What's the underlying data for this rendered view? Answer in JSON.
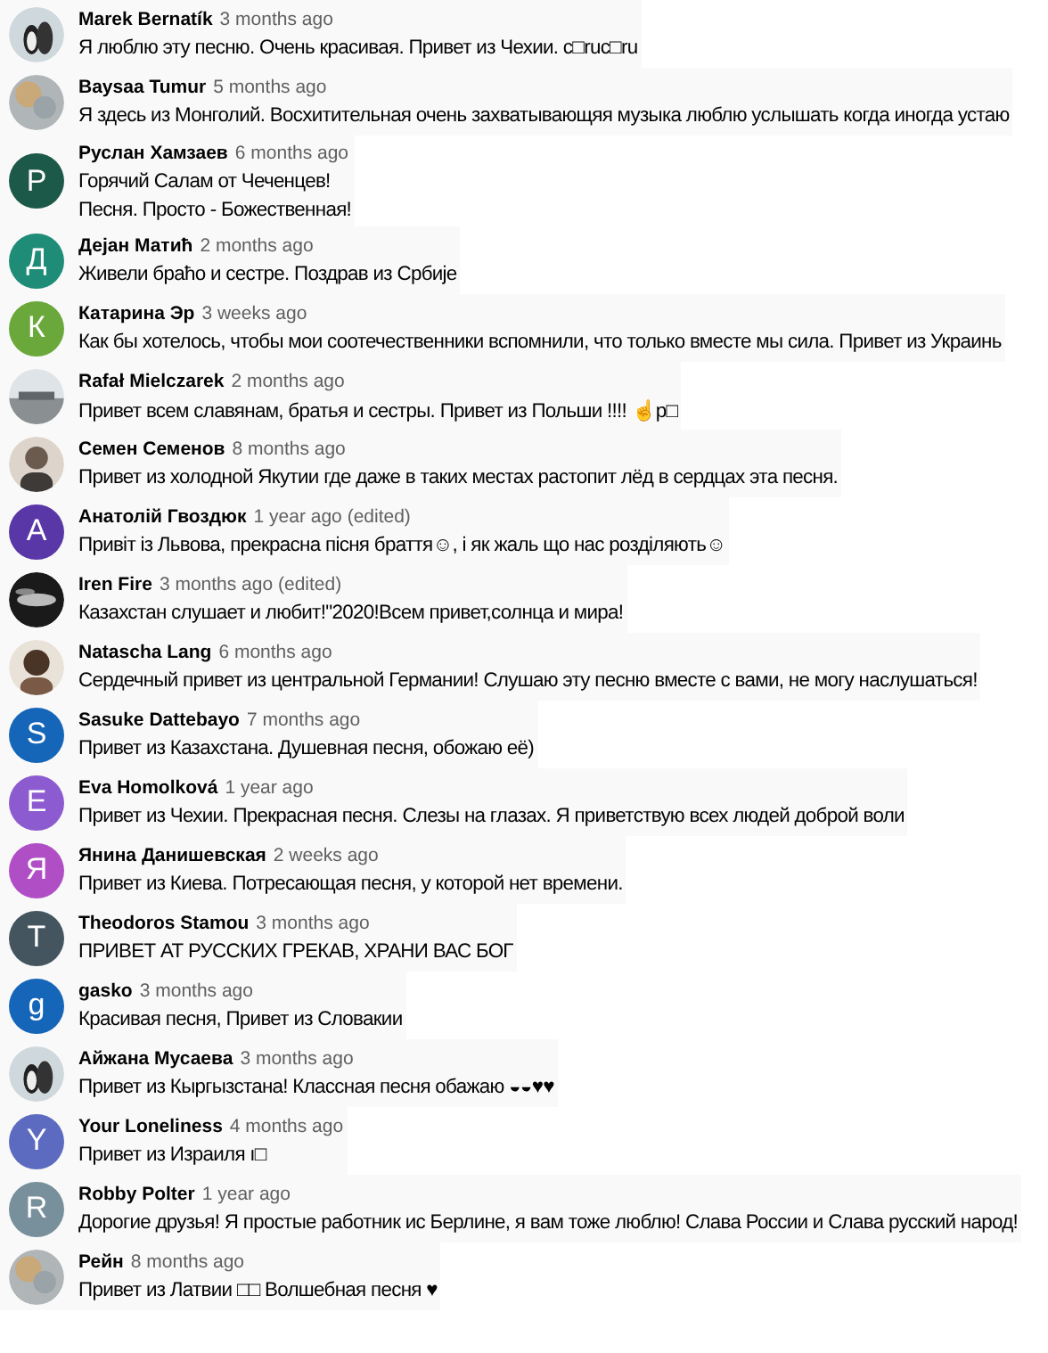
{
  "comments": [
    {
      "author": "Marek Bernatík",
      "time": "3 months ago",
      "lines": [
        "Я люблю эту песню. Очень красивая. Привет из Чехии. c□ruc□ru"
      ],
      "avatar": {
        "kind": "picture"
      }
    },
    {
      "author": "Baysaa Tumur",
      "time": "5 months ago",
      "lines": [
        "Я здесь из Монголий. Восхитительная очень захватывающяя музыка люблю услышать когда иногда устаю"
      ],
      "avatar": {
        "kind": "picture"
      }
    },
    {
      "author": "Руслан Хамзаев",
      "time": "6 months ago",
      "lines": [
        "Горячий Салам от Чеченцев!",
        "Песня. Просто - Божественная!"
      ],
      "avatar": {
        "kind": "letter",
        "letter": "Р",
        "color": "#1d5948"
      }
    },
    {
      "author": "Дејан Матић",
      "time": "2 months ago",
      "lines": [
        "Живели браћо и сестре. Поздрав из Србије"
      ],
      "avatar": {
        "kind": "letter",
        "letter": "Д",
        "color": "#1f8c78"
      }
    },
    {
      "author": "Катарина Эр",
      "time": "3 weeks ago",
      "lines": [
        "Как бы хотелось, чтобы мои соотечественники вспомнили, что только вместе мы сила. Привет из Украинь"
      ],
      "avatar": {
        "kind": "letter",
        "letter": "К",
        "color": "#6aa83c"
      }
    },
    {
      "author": "Rafał Mielczarek",
      "time": "2 months ago",
      "lines": [
        "Привет всем славянам, братья и сестры. Привет из Польши !!!! ☝p□"
      ],
      "avatar": {
        "kind": "picture"
      }
    },
    {
      "author": "Семен Семенов",
      "time": "8 months ago",
      "lines": [
        "Привет из холодной Якутии где даже в таких местах растопит лёд в сердцах эта песня."
      ],
      "avatar": {
        "kind": "picture"
      }
    },
    {
      "author": "Анатолій Гвоздюк",
      "time": "1 year ago (edited)",
      "lines": [
        "Привіт із Львова, прекрасна пісня браття☺, і як жаль що нас розділяють☺"
      ],
      "avatar": {
        "kind": "letter",
        "letter": "А",
        "color": "#5a37a6"
      }
    },
    {
      "author": "Iren Fire",
      "time": "3 months ago (edited)",
      "lines": [
        "Казахстан слушает и любит!\"2020!Всем привет,солнца и мира!"
      ],
      "avatar": {
        "kind": "picture"
      }
    },
    {
      "author": "Natascha Lang",
      "time": "6 months ago",
      "lines": [
        "Сердечный привет из центральной Германии! Слушаю эту песню вместе с вами, не могу наслушаться!"
      ],
      "avatar": {
        "kind": "picture"
      }
    },
    {
      "author": "Sasuke Dattebayo",
      "time": "7 months ago",
      "lines": [
        "Привет из Казахстана. Душевная песня, обожаю её)"
      ],
      "avatar": {
        "kind": "letter",
        "letter": "S",
        "color": "#1565b8"
      }
    },
    {
      "author": "Eva Homolková",
      "time": "1 year ago",
      "lines": [
        "Привет из Чехии. Прекрасная песня. Слезы на глазах. Я приветствую всех людей доброй воли"
      ],
      "avatar": {
        "kind": "letter",
        "letter": "E",
        "color": "#8d5bd0"
      }
    },
    {
      "author": "Янина Данишевская",
      "time": "2 weeks ago",
      "lines": [
        "Привет из Киева. Потресающая песня, у которой нет времени."
      ],
      "avatar": {
        "kind": "letter",
        "letter": "Я",
        "color": "#b04ec6"
      }
    },
    {
      "author": "Theodoros Stamou",
      "time": "3 months ago",
      "lines": [
        "ПРИВЕТ  АТ  РУССКИХ ГРЕКАВ, ХРАНИ ВАС БОГ"
      ],
      "avatar": {
        "kind": "letter",
        "letter": "T",
        "color": "#44555f"
      }
    },
    {
      "author": "gasko",
      "time": "3 months ago",
      "lines": [
        "Красивая песня, Привет из Словакии"
      ],
      "avatar": {
        "kind": "letter",
        "letter": "g",
        "color": "#1565b8"
      }
    },
    {
      "author": "Айжана Мусаева",
      "time": "3 months ago",
      "lines": [
        "Привет из Кыргызстана! Классная песня обажаю ◒◒♥♥"
      ],
      "avatar": {
        "kind": "picture"
      }
    },
    {
      "author": "Your Loneliness",
      "time": "4 months ago",
      "lines": [
        "Привет из Израиля ı□"
      ],
      "avatar": {
        "kind": "letter",
        "letter": "Y",
        "color": "#5c6bc0"
      }
    },
    {
      "author": "Robby Polter",
      "time": "1 year ago",
      "lines": [
        "Дорогие друзья!  Я простые работник ис Берлине, я вам тоже люблю! Слава России и Слава русский народ!"
      ],
      "avatar": {
        "kind": "letter",
        "letter": "R",
        "color": "#78909c"
      }
    },
    {
      "author": "Рейн",
      "time": "8 months ago",
      "lines": [
        "Привет из Латвии □□ Волшебная песня ♥"
      ],
      "avatar": {
        "kind": "picture"
      }
    }
  ]
}
